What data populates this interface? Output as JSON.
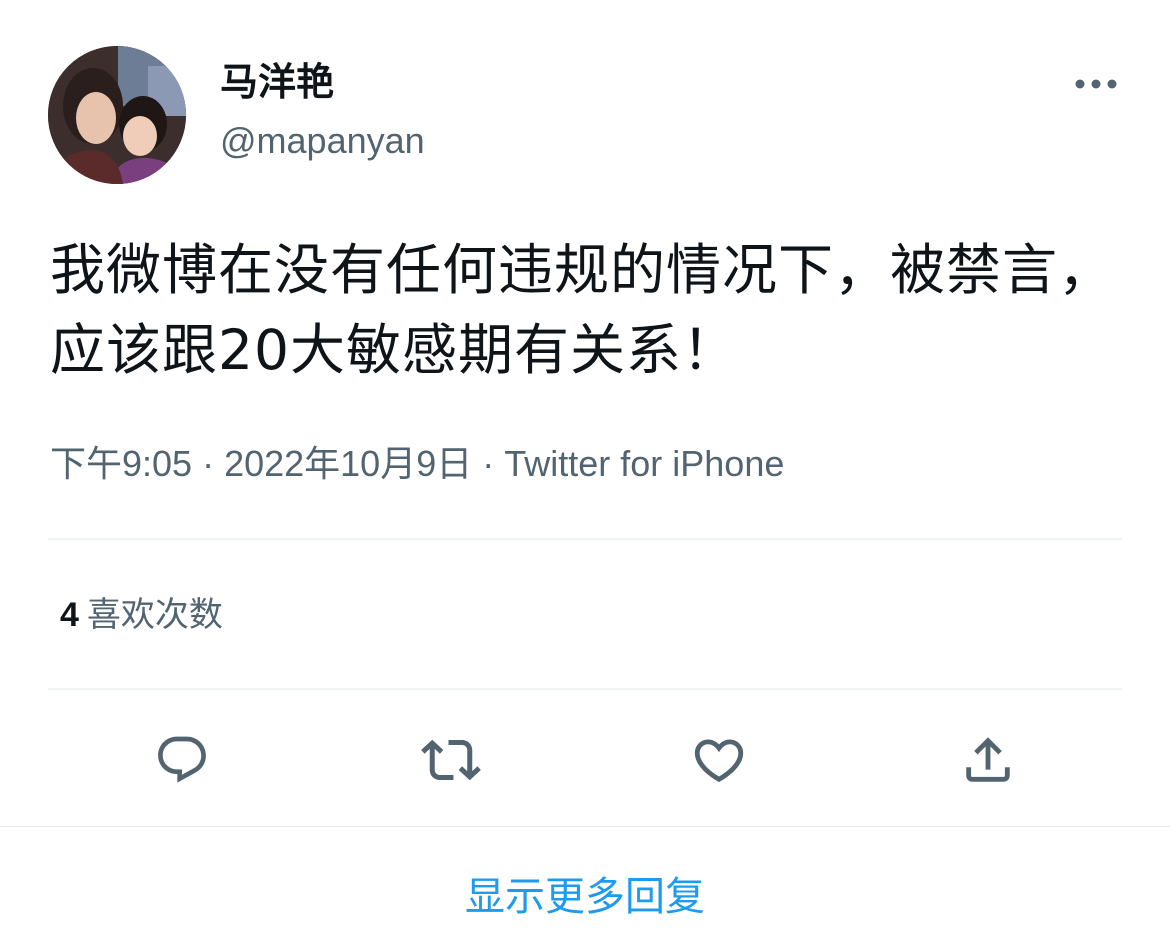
{
  "user": {
    "display_name": "马洋艳",
    "handle": "@mapanyan"
  },
  "tweet": {
    "text": "我微博在没有任何违规的情况下，被禁言，应该跟20大敏感期有关系！",
    "time": "下午9:05",
    "date": "2022年10月9日",
    "source": "Twitter for iPhone",
    "separator": " · "
  },
  "stats": {
    "likes_count": "4",
    "likes_label": "喜欢次数"
  },
  "actions": {
    "reply_icon": "reply-icon",
    "retweet_icon": "retweet-icon",
    "like_icon": "heart-icon",
    "share_icon": "share-icon"
  },
  "more_icon": "more-icon",
  "show_more_replies": "显示更多回复",
  "colors": {
    "primary_text": "#0f1419",
    "secondary_text": "#536471",
    "accent": "#1d9bf0",
    "divider": "#eff3f4"
  }
}
